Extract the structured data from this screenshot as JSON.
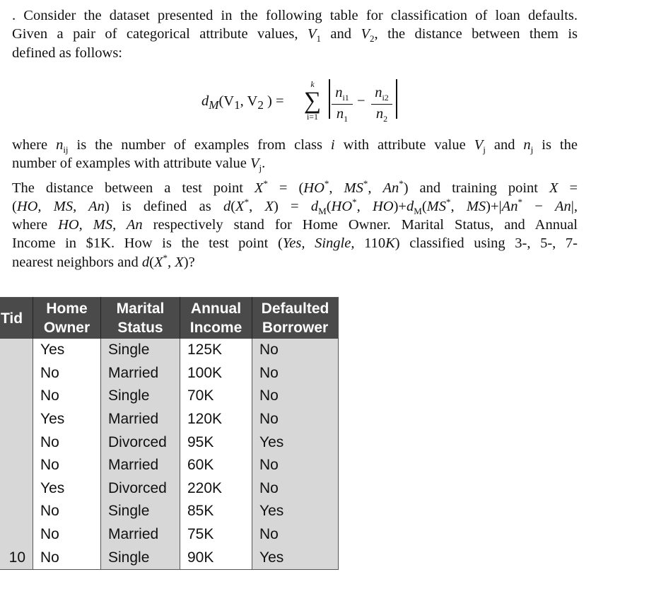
{
  "question": {
    "lines": [
      [
        {
          "t": ". Consider the dataset presented in the following table for classification of loan defaults.",
          "s": ""
        }
      ],
      [
        {
          "t": "Given a pair of categorical attribute values, ",
          "s": ""
        },
        {
          "t": "V",
          "s": "i"
        },
        {
          "t": "1",
          "s": "sub"
        },
        {
          "t": " and ",
          "s": ""
        },
        {
          "t": "V",
          "s": "i"
        },
        {
          "t": "2",
          "s": "sub"
        },
        {
          "t": ", the distance between them is",
          "s": ""
        }
      ],
      [
        {
          "t": "defined as follows:",
          "s": ""
        }
      ],
      [
        {
          "t": "where ",
          "s": ""
        },
        {
          "t": "n",
          "s": "i"
        },
        {
          "t": "ij",
          "s": "sub"
        },
        {
          "t": " is the number of examples from class ",
          "s": ""
        },
        {
          "t": "i",
          "s": "i"
        },
        {
          "t": " with attribute value ",
          "s": ""
        },
        {
          "t": "V",
          "s": "i"
        },
        {
          "t": "j",
          "s": "sub"
        },
        {
          "t": " and ",
          "s": ""
        },
        {
          "t": "n",
          "s": "i"
        },
        {
          "t": "j",
          "s": "sub"
        },
        {
          "t": " is the",
          "s": ""
        }
      ],
      [
        {
          "t": "number of examples with attribute value ",
          "s": ""
        },
        {
          "t": "V",
          "s": "i"
        },
        {
          "t": "j",
          "s": "sub"
        },
        {
          "t": ".",
          "s": ""
        }
      ],
      [
        {
          "t": "The distance between a test point ",
          "s": ""
        },
        {
          "t": "X",
          "s": "i"
        },
        {
          "t": "*",
          "s": "sup"
        },
        {
          "t": " = (",
          "s": ""
        },
        {
          "t": "HO",
          "s": "i"
        },
        {
          "t": "*",
          "s": "sup"
        },
        {
          "t": ", ",
          "s": ""
        },
        {
          "t": "MS",
          "s": "i"
        },
        {
          "t": "*",
          "s": "sup"
        },
        {
          "t": ", ",
          "s": ""
        },
        {
          "t": "An",
          "s": "i"
        },
        {
          "t": "*",
          "s": "sup"
        },
        {
          "t": ") and training point ",
          "s": ""
        },
        {
          "t": "X",
          "s": "i"
        },
        {
          "t": " =",
          "s": ""
        }
      ],
      [
        {
          "t": "(",
          "s": ""
        },
        {
          "t": "HO, MS, An",
          "s": "i"
        },
        {
          "t": ") is defined as ",
          "s": ""
        },
        {
          "t": "d",
          "s": "i"
        },
        {
          "t": "(",
          "s": ""
        },
        {
          "t": "X",
          "s": "i"
        },
        {
          "t": "*",
          "s": "sup"
        },
        {
          "t": ", ",
          "s": ""
        },
        {
          "t": "X",
          "s": "i"
        },
        {
          "t": ") = ",
          "s": ""
        },
        {
          "t": "d",
          "s": "i"
        },
        {
          "t": "M",
          "s": "sub"
        },
        {
          "t": "(",
          "s": ""
        },
        {
          "t": "HO",
          "s": "i"
        },
        {
          "t": "*",
          "s": "sup"
        },
        {
          "t": ", ",
          "s": ""
        },
        {
          "t": "HO",
          "s": "i"
        },
        {
          "t": ")+",
          "s": ""
        },
        {
          "t": "d",
          "s": "i"
        },
        {
          "t": "M",
          "s": "sub"
        },
        {
          "t": "(",
          "s": ""
        },
        {
          "t": "MS",
          "s": "i"
        },
        {
          "t": "*",
          "s": "sup"
        },
        {
          "t": ", ",
          "s": ""
        },
        {
          "t": "MS",
          "s": "i"
        },
        {
          "t": ")+|",
          "s": ""
        },
        {
          "t": "An",
          "s": "i"
        },
        {
          "t": "*",
          "s": "sup"
        },
        {
          "t": " − ",
          "s": ""
        },
        {
          "t": "An",
          "s": "i"
        },
        {
          "t": "|,",
          "s": ""
        }
      ],
      [
        {
          "t": "where ",
          "s": ""
        },
        {
          "t": "HO, MS, An",
          "s": "i"
        },
        {
          "t": " respectively stand for Home Owner. Marital Status, and Annual",
          "s": ""
        }
      ],
      [
        {
          "t": "Income in $1K. How is the test point (",
          "s": ""
        },
        {
          "t": "Yes, Single,",
          "s": "i"
        },
        {
          "t": " 110",
          "s": ""
        },
        {
          "t": "K",
          "s": "i"
        },
        {
          "t": ") classified using 3-, 5-, 7-",
          "s": ""
        }
      ],
      [
        {
          "t": "nearest neighbors and ",
          "s": ""
        },
        {
          "t": "d",
          "s": "i"
        },
        {
          "t": "(",
          "s": ""
        },
        {
          "t": "X",
          "s": "i"
        },
        {
          "t": "*",
          "s": "sup"
        },
        {
          "t": ", ",
          "s": ""
        },
        {
          "t": "X",
          "s": "i"
        },
        {
          "t": ")?",
          "s": ""
        }
      ]
    ]
  },
  "formula": {
    "lhs_d": "d",
    "lhs_sub": "M",
    "lhs_args": "(V",
    "v1_sub": "1",
    "comma": ", V",
    "v2_sub": "2",
    "eq": ") =",
    "upper": "k",
    "sigma": "∑",
    "lower": "i=1",
    "num1": "n",
    "num1_sub": "i1",
    "den1": "n",
    "den1_sub": "1",
    "minus": "−",
    "num2": "n",
    "num2_sub": "i2",
    "den2": "n",
    "den2_sub": "2"
  },
  "table": {
    "headers": [
      "Tid",
      "Home Owner",
      "Marital Status",
      "Annual Income",
      "Defaulted Borrower"
    ],
    "rows": [
      [
        "",
        "Yes",
        "Single",
        "125K",
        "No"
      ],
      [
        "",
        "No",
        "Married",
        "100K",
        "No"
      ],
      [
        "",
        "No",
        "Single",
        "70K",
        "No"
      ],
      [
        "",
        "Yes",
        "Married",
        "120K",
        "No"
      ],
      [
        "",
        "No",
        "Divorced",
        "95K",
        "Yes"
      ],
      [
        "",
        "No",
        "Married",
        "60K",
        "No"
      ],
      [
        "",
        "Yes",
        "Divorced",
        "220K",
        "No"
      ],
      [
        "",
        "No",
        "Single",
        "85K",
        "Yes"
      ],
      [
        "",
        "No",
        "Married",
        "75K",
        "No"
      ],
      [
        "10",
        "No",
        "Single",
        "90K",
        "Yes"
      ]
    ],
    "colors": {
      "header_bg": "#4a4a4a",
      "shaded_col": "#d7d7d7",
      "white_col": "#ffffff"
    }
  }
}
